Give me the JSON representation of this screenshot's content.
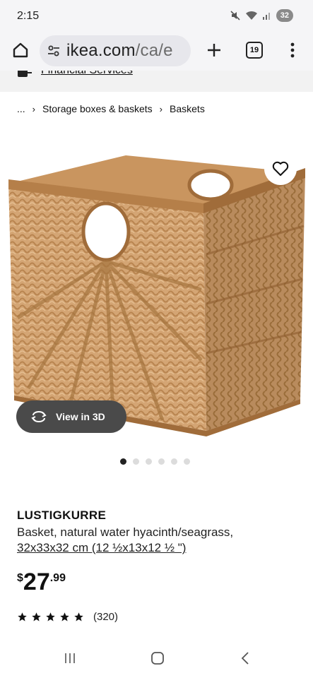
{
  "status_bar": {
    "time": "2:15",
    "battery": "32"
  },
  "browser": {
    "url_main": "ikea.com",
    "url_rest": "/ca/e",
    "tab_count": "19"
  },
  "peek": {
    "link_text": "Financial Services"
  },
  "breadcrumb": {
    "ellipsis": "...",
    "items": [
      "Storage boxes & baskets",
      "Baskets"
    ]
  },
  "image": {
    "view3d_label": "View in 3D",
    "dots_count": 6,
    "active_dot": 0
  },
  "product": {
    "name": "LUSTIGKURRE",
    "description": "Basket, natural water hyacinth/seagrass,",
    "size": "32x33x32 cm (12 ½x13x12 ½ \")",
    "price_currency": "$",
    "price_int": "27",
    "price_dec": ".99",
    "rating_stars": 5,
    "rating_count": "(320)"
  },
  "icons": {
    "home": "home-icon",
    "site_settings": "tune-icon",
    "new_tab": "plus-icon",
    "tabs": "tabs-icon",
    "menu": "more-vert-icon",
    "favorite": "heart-icon",
    "view3d": "rotate-3d-icon",
    "star": "star-icon"
  }
}
